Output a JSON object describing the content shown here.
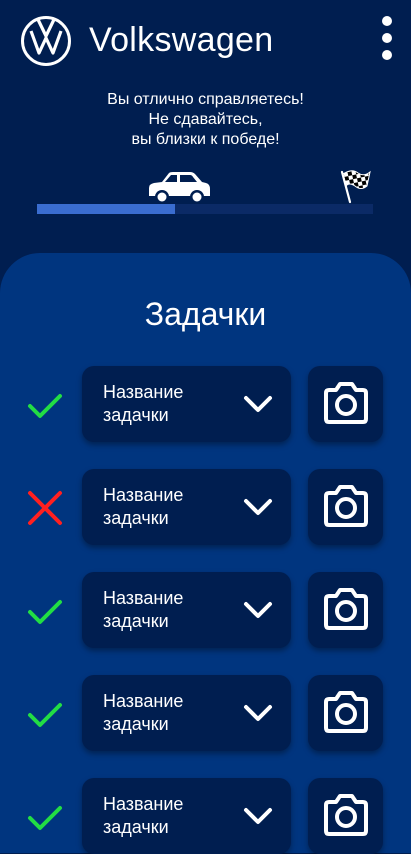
{
  "header": {
    "brand": "Volkswagen",
    "logo_icon": "vw-logo-icon",
    "menu_icon": "more-vert-icon"
  },
  "progress": {
    "message_line1": "Вы отлично справляетесь!",
    "message_line2": "Не сдавайтесь,",
    "message_line3": "вы близки к победе!",
    "value_fraction": 0.41,
    "car_icon": "car-icon",
    "finish_icon": "finish-flag-icon"
  },
  "tasks_section": {
    "title": "Задачки",
    "items": [
      {
        "name": "Название задачки",
        "status": "done"
      },
      {
        "name": "Название задачки",
        "status": "failed"
      },
      {
        "name": "Название задачки",
        "status": "done"
      },
      {
        "name": "Название задачки",
        "status": "done"
      },
      {
        "name": "Название задачки",
        "status": "done"
      }
    ]
  },
  "colors": {
    "background": "#001e50",
    "panel": "#00357f",
    "card": "#001e50",
    "progress_fill": "#3a6dd0",
    "progress_track": "#0b2a66",
    "done": "#22dd44",
    "failed": "#ff2020"
  }
}
